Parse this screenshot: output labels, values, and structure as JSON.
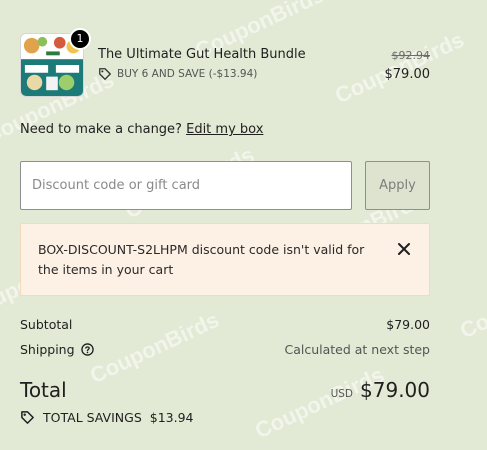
{
  "watermark": "CouponBirds",
  "product": {
    "name": "The Ultimate Gut Health Bundle",
    "quantity": "1",
    "discount": "BUY 6 AND SAVE (-$13.94)",
    "original_price": "$92.94",
    "price": "$79.00"
  },
  "change": {
    "prompt": "Need to make a change?",
    "link": "Edit my box"
  },
  "discount_form": {
    "placeholder": "Discount code or gift card",
    "value": "",
    "apply_label": "Apply"
  },
  "error": {
    "message": "BOX-DISCOUNT-S2LHPM discount code isn't valid for the items in your cart"
  },
  "summary": {
    "subtotal_label": "Subtotal",
    "subtotal_value": "$79.00",
    "shipping_label": "Shipping",
    "shipping_value": "Calculated at next step",
    "total_label": "Total",
    "currency": "USD",
    "total_value": "$79.00",
    "savings_label": "TOTAL SAVINGS",
    "savings_value": "$13.94"
  },
  "colors": {
    "background": "#e2e9d4",
    "error_bg": "#fdf0e4",
    "error_border": "#f5d9bd",
    "badge": "#000000"
  }
}
